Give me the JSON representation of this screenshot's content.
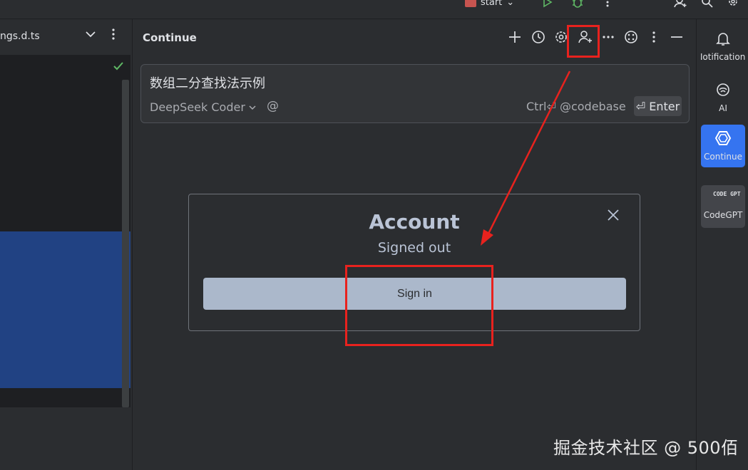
{
  "topbar": {
    "run_config": "start"
  },
  "editor": {
    "file_tab": "ngs.d.ts"
  },
  "continue_panel": {
    "title": "Continue",
    "input_text": "数组二分查找法示例",
    "model": "DeepSeek Coder",
    "mention": "@",
    "shortcut_hint": "Ctrl⏎ @codebase",
    "enter_label": "⏎ Enter"
  },
  "account_dialog": {
    "title": "Account",
    "status": "Signed out",
    "sign_in_label": "Sign in"
  },
  "toolstrip": {
    "items": [
      {
        "label": "Notifications",
        "icon": "bell-icon"
      },
      {
        "label": "AI",
        "icon": "ai-icon"
      },
      {
        "label": "Continue",
        "icon": "continue-icon"
      },
      {
        "label": "CodeGPT",
        "icon": "codegpt-icon"
      }
    ]
  },
  "codegpt_logo": "CODE GPT",
  "watermark": "掘金技术社区 @ 500佰",
  "colors": {
    "accent": "#3574f0",
    "annotation": "#e8221e",
    "selection": "#214283"
  }
}
